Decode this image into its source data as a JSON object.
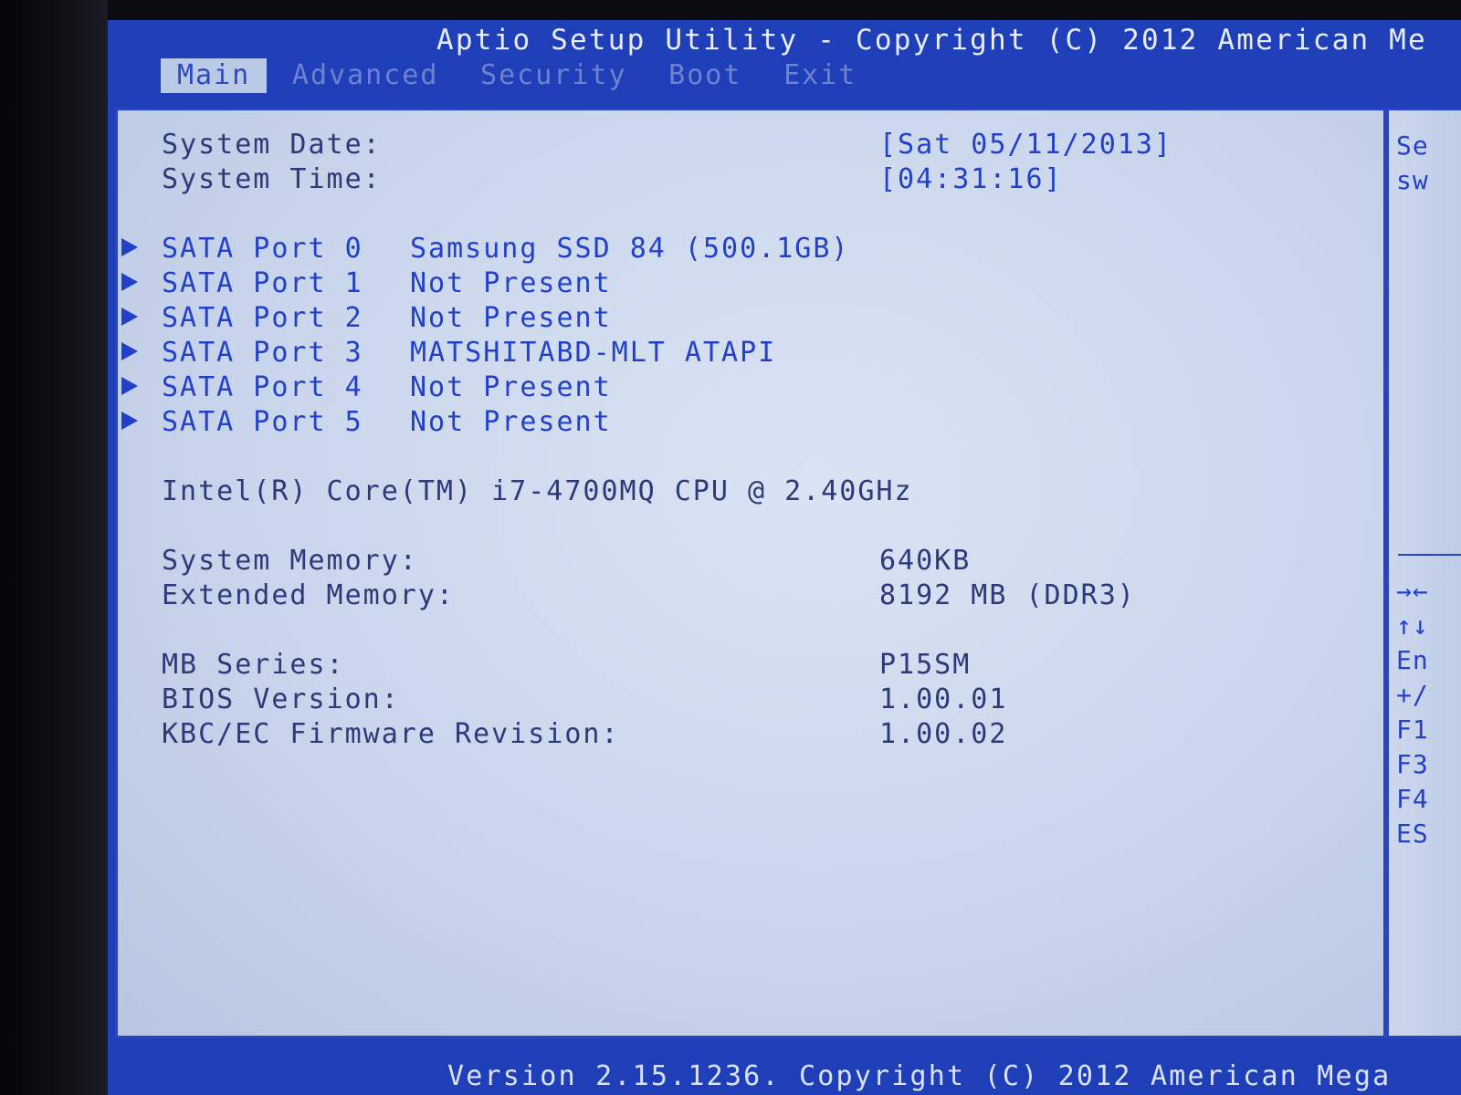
{
  "header": {
    "title": "Aptio Setup Utility - Copyright (C) 2012 American Me",
    "tabs": [
      {
        "label": "Main",
        "active": true
      },
      {
        "label": "Advanced",
        "active": false
      },
      {
        "label": "Security",
        "active": false
      },
      {
        "label": "Boot",
        "active": false
      },
      {
        "label": "Exit",
        "active": false
      }
    ]
  },
  "main": {
    "system_date": {
      "label": "System Date:",
      "value": "[Sat 05/11/2013]"
    },
    "system_time": {
      "label": "System Time:",
      "value": "[04:31:16]"
    },
    "sata_ports": [
      {
        "port": "SATA Port 0",
        "device": "Samsung SSD 84 (500.1GB)"
      },
      {
        "port": "SATA Port 1",
        "device": "Not Present"
      },
      {
        "port": "SATA Port 2",
        "device": "Not Present"
      },
      {
        "port": "SATA Port 3",
        "device": "MATSHITABD-MLT ATAPI"
      },
      {
        "port": "SATA Port 4",
        "device": "Not Present"
      },
      {
        "port": "SATA Port 5",
        "device": "Not Present"
      }
    ],
    "cpu": "Intel(R) Core(TM) i7-4700MQ CPU @ 2.40GHz",
    "system_memory": {
      "label": "System Memory:",
      "value": "640KB"
    },
    "extended_memory": {
      "label": "Extended Memory:",
      "value": "8192 MB (DDR3)"
    },
    "mb_series": {
      "label": "MB Series:",
      "value": "P15SM"
    },
    "bios_version": {
      "label": "BIOS Version:",
      "value": "1.00.01"
    },
    "kbc_ec_firmware": {
      "label": "KBC/EC Firmware Revision:",
      "value": "1.00.02"
    }
  },
  "help_panel": {
    "lines_top": [
      "Se",
      "sw"
    ],
    "keys": [
      "→←",
      "↑↓",
      "En",
      "+/",
      "F1",
      "F3",
      "F4",
      "ES"
    ]
  },
  "footer": {
    "text": "Version 2.15.1236. Copyright (C) 2012 American Mega"
  },
  "colors": {
    "frame_blue": "#1f3fb8",
    "panel_bg": "#cad6ec",
    "value_blue": "#2340c8",
    "label_text": "#2d3a7a"
  }
}
